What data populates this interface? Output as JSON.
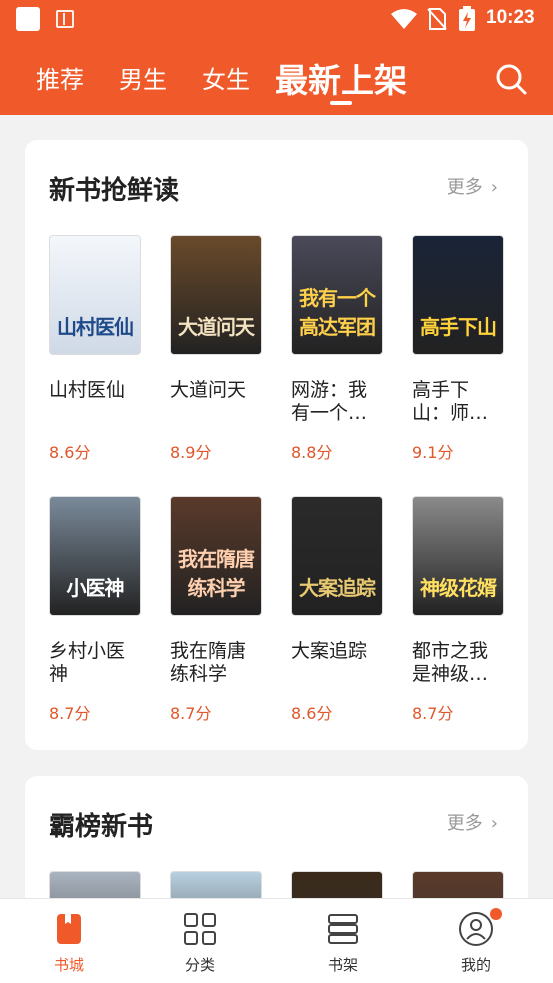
{
  "status_bar": {
    "time": "10:23"
  },
  "tabs": [
    {
      "label": "推荐",
      "active": false
    },
    {
      "label": "男生",
      "active": false
    },
    {
      "label": "女生",
      "active": false
    },
    {
      "label": "最新上架",
      "active": true
    }
  ],
  "section1": {
    "title": "新书抢鲜读",
    "more": "更多",
    "books": [
      {
        "title": "山村医仙",
        "score": "8.6分",
        "cover_text": "山村医仙",
        "cover_bg": "#e8eef5",
        "cover_fg": "#1f4a8a"
      },
      {
        "title": "大道问天",
        "score": "8.9分",
        "cover_text": "大道问天",
        "cover_bg": "#6a4a2a",
        "cover_fg": "#f3e3c0"
      },
      {
        "title": "网游：我有一个…",
        "score": "8.8分",
        "cover_text": "我有一个高达军团",
        "cover_bg": "#4a4a5a",
        "cover_fg": "#ffd04a"
      },
      {
        "title": "高手下山：师…",
        "score": "9.1分",
        "cover_text": "高手下山",
        "cover_bg": "#1a2438",
        "cover_fg": "#ffd23a"
      },
      {
        "title": "乡村小医神",
        "score": "8.7分",
        "cover_text": "小医神",
        "cover_bg": "#7a8a9a",
        "cover_fg": "#ffffff"
      },
      {
        "title": "我在隋唐练科学",
        "score": "8.7分",
        "cover_text": "我在隋唐练科学",
        "cover_bg": "#5a3a2a",
        "cover_fg": "#ffd0b0"
      },
      {
        "title": "大案追踪",
        "score": "8.6分",
        "cover_text": "大案追踪",
        "cover_bg": "#2a2a2a",
        "cover_fg": "#e8c870"
      },
      {
        "title": "都市之我是神级…",
        "score": "8.7分",
        "cover_text": "神级花婿",
        "cover_bg": "#8a8a8a",
        "cover_fg": "#ffe060"
      }
    ]
  },
  "section2": {
    "title": "霸榜新书",
    "more": "更多",
    "covers": [
      "#aab4c0",
      "#b8d0e0",
      "#3a2a1a",
      "#5a3a2a"
    ]
  },
  "bottom_nav": [
    {
      "label": "书城",
      "active": true,
      "icon": "bookstore-icon"
    },
    {
      "label": "分类",
      "active": false,
      "icon": "category-icon"
    },
    {
      "label": "书架",
      "active": false,
      "icon": "bookshelf-icon"
    },
    {
      "label": "我的",
      "active": false,
      "icon": "profile-icon"
    }
  ],
  "colors": {
    "accent": "#f05a2a",
    "score": "#e0572a"
  }
}
